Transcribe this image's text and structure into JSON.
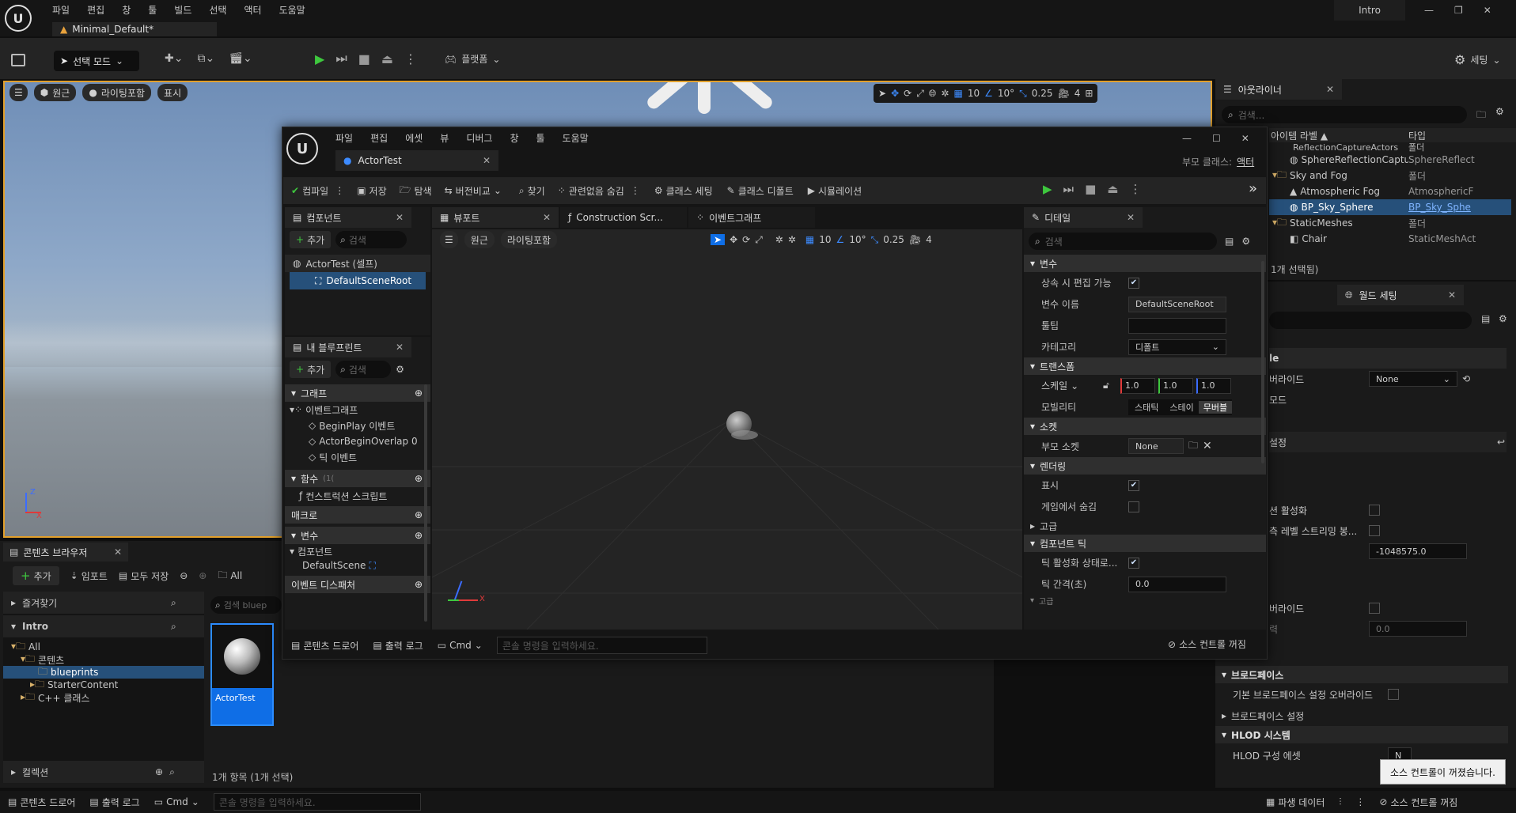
{
  "main": {
    "menu": [
      "파일",
      "편집",
      "창",
      "툴",
      "빌드",
      "선택",
      "액터",
      "도움말"
    ],
    "project_tab": "Minimal_Default*",
    "project_name": "Intro",
    "toolbar": {
      "select_mode": "선택 모드",
      "platform": "플랫폼",
      "settings": "세팅"
    },
    "viewport_bar": {
      "perspective": "원근",
      "lit": "라이팅포함",
      "show": "표시",
      "grid": "10",
      "angle": "10°",
      "scale": "0.25",
      "camera": "4"
    }
  },
  "outliner": {
    "title": "아웃라이너",
    "search_placeholder": "검색...",
    "col_label": "아이템 라벨 ▲",
    "col_type": "타입",
    "rows": [
      {
        "label": "ReflectionCaptureActors",
        "type": "폴더"
      },
      {
        "label": "SphereReflectionCapture10",
        "type": "SphereReflect"
      },
      {
        "label": "Sky and Fog",
        "type": "폴더"
      },
      {
        "label": "Atmospheric Fog",
        "type": "AtmosphericF"
      },
      {
        "label": "BP_Sky_Sphere",
        "type": "BP_Sky_Sphe"
      },
      {
        "label": "StaticMeshes",
        "type": "폴더"
      },
      {
        "label": "Chair",
        "type": "StaticMeshAct"
      }
    ],
    "status": "1개 선택됨)"
  },
  "world_settings": {
    "title": "월드 세팅",
    "rows": [
      {
        "label": "le",
        "value": ""
      },
      {
        "label": "버라이드",
        "value": "None"
      },
      {
        "label": "모드",
        "value": ""
      },
      {
        "label": "설정",
        "value": ""
      },
      {
        "label": "션 활성화",
        "value": ""
      },
      {
        "label": "측 레벨 스트리밍 봉...",
        "value": ""
      },
      {
        "label": "",
        "value": "-1048575.0"
      },
      {
        "label": "버라이드",
        "value": ""
      },
      {
        "label": "력",
        "value": "0.0"
      }
    ],
    "broadphase": "브로드페이스",
    "broadphase_override": "기본 브로드페이스 설정 오버라이드",
    "broadphase_settings": "브로드페이스 설정",
    "hlod": "HLOD 시스템",
    "hlod_asset": "HLOD 구성 에셋",
    "hlod_asset_value": "N",
    "toast": "소스 컨트롤이 꺼졌습니다."
  },
  "content_browser": {
    "title": "콘텐츠 브라우저",
    "add": "추가",
    "import": "임포트",
    "save_all": "모두 저장",
    "path": "All",
    "favorites": "즐겨찾기",
    "project": "Intro",
    "tree": [
      "All",
      "콘텐츠",
      "blueprints",
      "StarterContent",
      "C++ 클래스"
    ],
    "collections": "컬렉션",
    "search_placeholder": "검색 bluep",
    "asset_name": "ActorTest",
    "status": "1개 항목 (1개 선택)"
  },
  "bottom_bar": {
    "content_drawer": "콘텐츠 드로어",
    "output_log": "출력 로그",
    "cmd": "Cmd",
    "console_placeholder": "콘솔 명령을 입력하세요.",
    "derived_data": "파생 데이터",
    "source_control": "소스 컨트롤 꺼짐"
  },
  "bp_editor": {
    "menu": [
      "파일",
      "편집",
      "에셋",
      "뷰",
      "디버그",
      "창",
      "툴",
      "도움말"
    ],
    "tab": "ActorTest",
    "parent_class_label": "부모 클래스:",
    "parent_class": "액터",
    "toolbar": [
      "컴파일",
      "저장",
      "탐색",
      "버전비교",
      "찾기",
      "관련없음 숨김",
      "클래스 세팅",
      "클래스 디폴트",
      "시뮬레이션"
    ],
    "components": {
      "title": "컴포넌트",
      "add": "추가",
      "search": "검색",
      "items": [
        "ActorTest (셀프)",
        "DefaultSceneRoot"
      ]
    },
    "my_blueprint": {
      "title": "내 블루프린트",
      "add": "추가",
      "search": "검색",
      "graph": "그래프",
      "event_graph": "이벤트그래프",
      "events": [
        "BeginPlay 이벤트",
        "ActorBeginOverlap 0",
        "틱 이벤트"
      ],
      "functions": "함수",
      "functions_count": "(1(",
      "construction_script": "컨스트럭션 스크립트",
      "macros": "매크로",
      "variables": "변수",
      "components_group": "컴포넌트",
      "default_scene": "DefaultScene",
      "dispatchers": "이벤트 디스패처"
    },
    "tabs": [
      "뷰포트",
      "Construction Scr...",
      "이벤트그래프"
    ],
    "viewport_bar": {
      "perspective": "원근",
      "lit": "라이팅포함",
      "grid": "10",
      "angle": "10°",
      "scale": "0.25",
      "camera": "4"
    },
    "details": {
      "title": "디테일",
      "search": "검색",
      "sections": {
        "variable": "변수",
        "transform": "트랜스폼",
        "socket": "소켓",
        "rendering": "렌더링",
        "advanced": "고급",
        "component_tick": "컴포넌트 틱",
        "cut": "고급"
      },
      "instance_editable": "상속 시 편집 가능",
      "variable_name": "변수 이름",
      "variable_name_value": "DefaultSceneRoot",
      "tooltip": "툴팁",
      "category": "카테고리",
      "category_value": "디폴트",
      "scale": "스케일",
      "scale_values": [
        "1.0",
        "1.0",
        "1.0"
      ],
      "mobility": "모빌리티",
      "mobility_options": [
        "스태틱",
        "스테이",
        "무버블"
      ],
      "parent_socket": "부모 소켓",
      "parent_socket_value": "None",
      "visible": "표시",
      "hidden_in_game": "게임에서 숨김",
      "tick_enabled": "틱 활성화 상태로...",
      "tick_interval": "틱 간격(초)",
      "tick_interval_value": "0.0"
    },
    "bottom": {
      "content_drawer": "콘텐츠 드로어",
      "output_log": "출력 로그",
      "cmd": "Cmd",
      "console_placeholder": "콘솔 명령을 입력하세요.",
      "source_control": "소스 컨트롤 꺼짐"
    }
  }
}
